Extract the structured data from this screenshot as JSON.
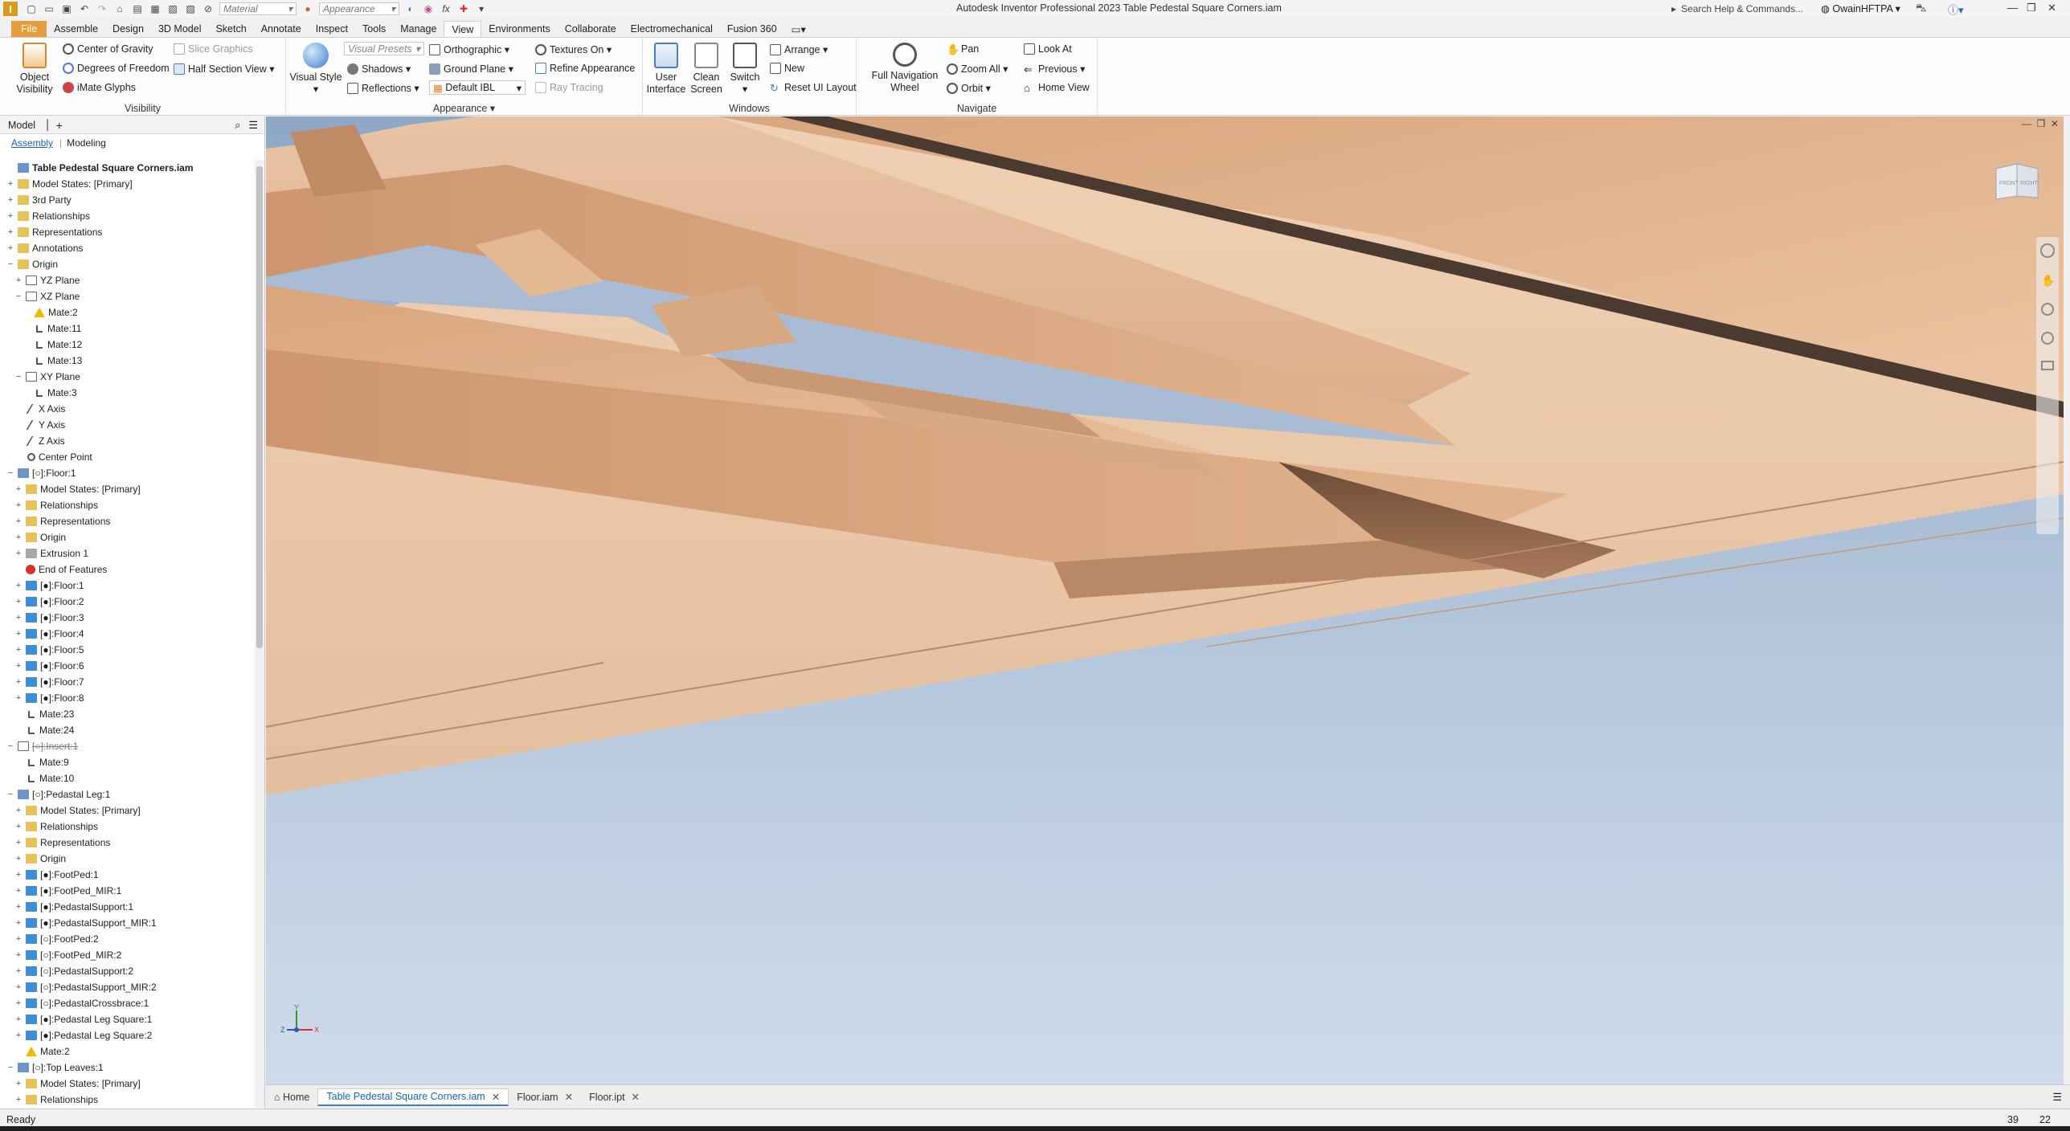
{
  "title_bar": {
    "app_title": "Autodesk Inventor Professional 2023   Table Pedestal Square Corners.iam",
    "material_combo": "Material",
    "appearance_combo": "Appearance",
    "search_placeholder": "Search Help & Commands...",
    "user_name": "OwainHFTPA"
  },
  "ribbon_tabs": [
    "Assemble",
    "Design",
    "3D Model",
    "Sketch",
    "Annotate",
    "Inspect",
    "Tools",
    "Manage",
    "View",
    "Environments",
    "Collaborate",
    "Electromechanical",
    "Fusion 360"
  ],
  "file_tab": "File",
  "active_tab": "View",
  "ribbon": {
    "visibility": {
      "title": "Visibility",
      "object_visibility": "Object\nVisibility",
      "center_of_gravity": "Center of Gravity",
      "degrees_of_freedom": "Degrees of Freedom",
      "imate_glyphs": "iMate Glyphs",
      "slice_graphics": "Slice Graphics",
      "half_section_view": "Half Section View"
    },
    "appearance": {
      "title": "Appearance",
      "visual_style": "Visual Style",
      "visual_presets": "Visual Presets",
      "orthographic": "Orthographic",
      "shadows": "Shadows",
      "ground_plane": "Ground Plane",
      "reflections": "Reflections",
      "default_ibl": "Default IBL",
      "textures_on": "Textures On",
      "refine_appearance": "Refine Appearance",
      "ray_tracing": "Ray Tracing"
    },
    "windows": {
      "title": "Windows",
      "user_interface": "User\nInterface",
      "clean_screen": "Clean\nScreen",
      "switch": "Switch",
      "arrange": "Arrange",
      "new": "New",
      "reset_ui_layout": "Reset UI Layout"
    },
    "navigate": {
      "title": "Navigate",
      "full_navigation_wheel": "Full Navigation\nWheel",
      "pan": "Pan",
      "zoom_all": "Zoom All",
      "orbit": "Orbit",
      "look_at": "Look At",
      "previous": "Previous",
      "home_view": "Home View"
    }
  },
  "browser": {
    "header": "Model",
    "tab_assembly": "Assembly",
    "tab_modeling": "Modeling",
    "nodes": [
      {
        "label": "Table Pedestal Square Corners.iam",
        "level": 0,
        "exp": "",
        "icon": "asm",
        "bold": true
      },
      {
        "label": "Model States: [Primary]",
        "level": 0,
        "exp": "+",
        "icon": "folder"
      },
      {
        "label": "3rd Party",
        "level": 0,
        "exp": "+",
        "icon": "folder"
      },
      {
        "label": "Relationships",
        "level": 0,
        "exp": "+",
        "icon": "folder"
      },
      {
        "label": "Representations",
        "level": 0,
        "exp": "+",
        "icon": "folder"
      },
      {
        "label": "Annotations",
        "level": 0,
        "exp": "+",
        "icon": "folder"
      },
      {
        "label": "Origin",
        "level": 0,
        "exp": "-",
        "icon": "folder"
      },
      {
        "label": "YZ Plane",
        "level": 1,
        "exp": "+",
        "icon": "plane"
      },
      {
        "label": "XZ Plane",
        "level": 1,
        "exp": "-",
        "icon": "plane"
      },
      {
        "label": "Mate:2",
        "level": 2,
        "exp": "",
        "icon": "warn"
      },
      {
        "label": "Mate:11",
        "level": 2,
        "exp": "",
        "icon": "mate"
      },
      {
        "label": "Mate:12",
        "level": 2,
        "exp": "",
        "icon": "mate"
      },
      {
        "label": "Mate:13",
        "level": 2,
        "exp": "",
        "icon": "mate"
      },
      {
        "label": "XY Plane",
        "level": 1,
        "exp": "-",
        "icon": "plane"
      },
      {
        "label": "Mate:3",
        "level": 2,
        "exp": "",
        "icon": "mate"
      },
      {
        "label": "X Axis",
        "level": 1,
        "exp": "",
        "icon": "axis"
      },
      {
        "label": "Y Axis",
        "level": 1,
        "exp": "",
        "icon": "axis"
      },
      {
        "label": "Z Axis",
        "level": 1,
        "exp": "",
        "icon": "axis"
      },
      {
        "label": "Center Point",
        "level": 1,
        "exp": "",
        "icon": "point"
      },
      {
        "label": "[○]:Floor:1",
        "level": 0,
        "exp": "-",
        "icon": "asm"
      },
      {
        "label": "Model States: [Primary]",
        "level": 1,
        "exp": "+",
        "icon": "folder"
      },
      {
        "label": "Relationships",
        "level": 1,
        "exp": "+",
        "icon": "folder"
      },
      {
        "label": "Representations",
        "level": 1,
        "exp": "+",
        "icon": "folder"
      },
      {
        "label": "Origin",
        "level": 1,
        "exp": "+",
        "icon": "folder"
      },
      {
        "label": "Extrusion 1",
        "level": 1,
        "exp": "+",
        "icon": "extr"
      },
      {
        "label": "End of Features",
        "level": 1,
        "exp": "",
        "icon": "err"
      },
      {
        "label": "[●]:Floor:1",
        "level": 1,
        "exp": "+",
        "icon": "part"
      },
      {
        "label": "[●]:Floor:2",
        "level": 1,
        "exp": "+",
        "icon": "part"
      },
      {
        "label": "[●]:Floor:3",
        "level": 1,
        "exp": "+",
        "icon": "part"
      },
      {
        "label": "[●]:Floor:4",
        "level": 1,
        "exp": "+",
        "icon": "part"
      },
      {
        "label": "[●]:Floor:5",
        "level": 1,
        "exp": "+",
        "icon": "part"
      },
      {
        "label": "[●]:Floor:6",
        "level": 1,
        "exp": "+",
        "icon": "part"
      },
      {
        "label": "[●]:Floor:7",
        "level": 1,
        "exp": "+",
        "icon": "part"
      },
      {
        "label": "[●]:Floor:8",
        "level": 1,
        "exp": "+",
        "icon": "part"
      },
      {
        "label": "Mate:23",
        "level": 1,
        "exp": "",
        "icon": "mate"
      },
      {
        "label": "Mate:24",
        "level": 1,
        "exp": "",
        "icon": "mate"
      },
      {
        "label": "[○]:Insert:1",
        "level": 0,
        "exp": "-",
        "icon": "plane",
        "struck": true
      },
      {
        "label": "Mate:9",
        "level": 1,
        "exp": "",
        "icon": "mate"
      },
      {
        "label": "Mate:10",
        "level": 1,
        "exp": "",
        "icon": "mate"
      },
      {
        "label": "[○]:Pedastal Leg:1",
        "level": 0,
        "exp": "-",
        "icon": "asm"
      },
      {
        "label": "Model States: [Primary]",
        "level": 1,
        "exp": "+",
        "icon": "folder"
      },
      {
        "label": "Relationships",
        "level": 1,
        "exp": "+",
        "icon": "folder"
      },
      {
        "label": "Representations",
        "level": 1,
        "exp": "+",
        "icon": "folder"
      },
      {
        "label": "Origin",
        "level": 1,
        "exp": "+",
        "icon": "folder"
      },
      {
        "label": "[●]:FootPed:1",
        "level": 1,
        "exp": "+",
        "icon": "part"
      },
      {
        "label": "[●]:FootPed_MIR:1",
        "level": 1,
        "exp": "+",
        "icon": "part"
      },
      {
        "label": "[●]:PedastalSupport:1",
        "level": 1,
        "exp": "+",
        "icon": "part"
      },
      {
        "label": "[●]:PedastalSupport_MIR:1",
        "level": 1,
        "exp": "+",
        "icon": "part"
      },
      {
        "label": "[○]:FootPed:2",
        "level": 1,
        "exp": "+",
        "icon": "part"
      },
      {
        "label": "[○]:FootPed_MIR:2",
        "level": 1,
        "exp": "+",
        "icon": "part"
      },
      {
        "label": "[○]:PedastalSupport:2",
        "level": 1,
        "exp": "+",
        "icon": "part"
      },
      {
        "label": "[○]:PedastalSupport_MIR:2",
        "level": 1,
        "exp": "+",
        "icon": "part"
      },
      {
        "label": "[○]:PedastalCrossbrace:1",
        "level": 1,
        "exp": "+",
        "icon": "part"
      },
      {
        "label": "[●]:Pedastal Leg Square:1",
        "level": 1,
        "exp": "+",
        "icon": "part"
      },
      {
        "label": "[●]:Pedastal Leg Square:2",
        "level": 1,
        "exp": "+",
        "icon": "part"
      },
      {
        "label": "Mate:2",
        "level": 1,
        "exp": "",
        "icon": "warn"
      },
      {
        "label": "[○]:Top Leaves:1",
        "level": 0,
        "exp": "-",
        "icon": "asm"
      },
      {
        "label": "Model States: [Primary]",
        "level": 1,
        "exp": "+",
        "icon": "folder"
      },
      {
        "label": "Relationships",
        "level": 1,
        "exp": "+",
        "icon": "folder"
      }
    ]
  },
  "viewcube": {
    "front": "FRONT",
    "right": "RIGHT"
  },
  "triad": {
    "x": "X",
    "y": "Y",
    "z": "Z"
  },
  "doc_tabs": {
    "home": "Home",
    "tabs": [
      {
        "label": "Table Pedestal Square Corners.iam",
        "active": true
      },
      {
        "label": "Floor.iam",
        "active": false
      },
      {
        "label": "Floor.ipt",
        "active": false
      }
    ]
  },
  "status": {
    "text": "Ready",
    "value_a": "39",
    "value_b": "22"
  },
  "colors": {
    "accent": "#3b7fd0",
    "file_tab": "#e59c3c",
    "wood_light": "#e9c6a6",
    "wood_dark": "#c9936c",
    "sky": "#b5c7dc"
  }
}
